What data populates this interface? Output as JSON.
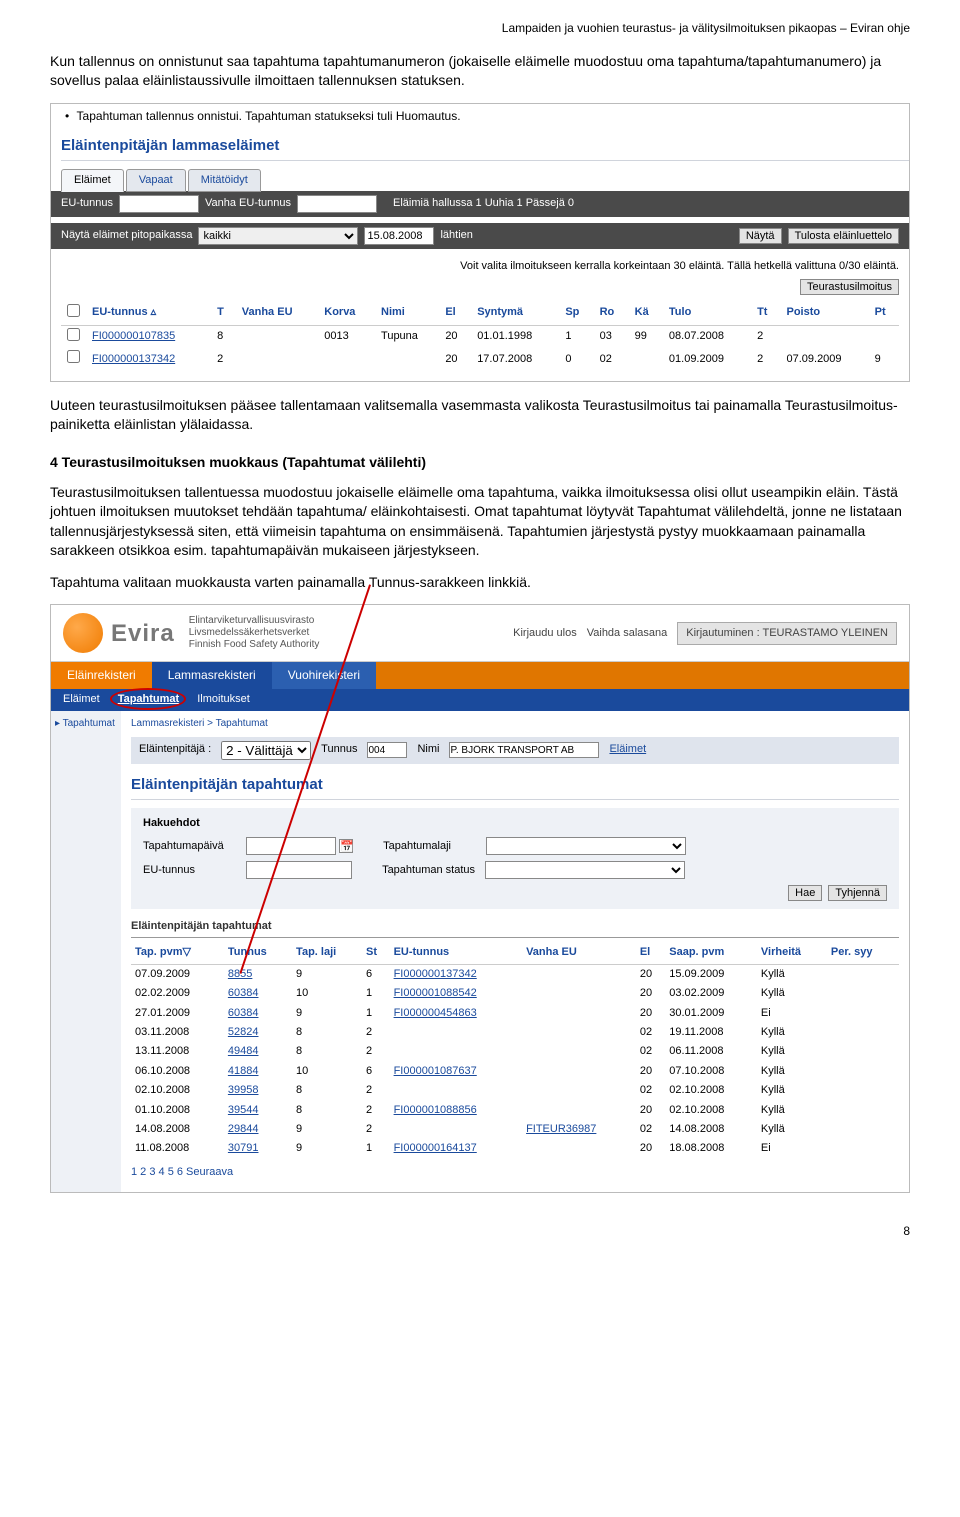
{
  "header_right": "Lampaiden ja vuohien teurastus- ja välitysilmoituksen pikaopas – Eviran ohje",
  "p1": "Kun tallennus on onnistunut saa tapahtuma tapahtumanumeron (jokaiselle eläimelle muodostuu oma tapahtuma/tapahtumanumero) ja sovellus palaa eläinlistaussivulle ilmoittaen tallennuksen statuksen.",
  "bullet1": "Tapahtuman tallennus onnistui. Tapahtuman statukseksi tuli Huomautus.",
  "sc1": {
    "panel_title": "Eläintenpitäjän lammaseläimet",
    "tabs": [
      "Eläimet",
      "Vapaat",
      "Mitätöidyt"
    ],
    "filter": {
      "eu_label": "EU-tunnus",
      "vanha_label": "Vanha EU-tunnus",
      "stats": "Eläimiä hallussa 1 Uuhia 1 Pässejä 0",
      "show_label": "Näytä eläimet pitopaikassa",
      "select_value": "kaikki",
      "date": "15.08.2008",
      "lahtien": "lähtien",
      "btn_nayta": "Näytä",
      "btn_tulosta": "Tulosta eläinluettelo"
    },
    "note": "Voit valita ilmoitukseen kerralla korkeintaan 30 eläintä. Tällä hetkellä valittuna 0/30 eläintä.",
    "btn_teurastus": "Teurastusilmoitus",
    "columns": [
      "",
      "EU-tunnus ▵",
      "T",
      "Vanha EU",
      "Korva",
      "Nimi",
      "El",
      "Syntymä",
      "Sp",
      "Ro",
      "Kä",
      "Tulo",
      "Tt",
      "Poisto",
      "Pt"
    ],
    "rows": [
      [
        "",
        "FI000000107835",
        "8",
        "",
        "0013",
        "Tupuna",
        "20",
        "01.01.1998",
        "1",
        "03",
        "99",
        "08.07.2008",
        "2",
        "",
        ""
      ],
      [
        "",
        "FI000000137342",
        "2",
        "",
        "",
        "",
        "20",
        "17.07.2008",
        "0",
        "02",
        "",
        "01.09.2009",
        "2",
        "07.09.2009",
        "9"
      ]
    ]
  },
  "p2": "Uuteen teurastusilmoituksen pääsee tallentamaan valitsemalla vasemmasta valikosta Teurastusilmoitus tai painamalla Teurastusilmoitus-painiketta eläinlistan ylälaidassa.",
  "h1": "4 Teurastusilmoituksen muokkaus (Tapahtumat välilehti)",
  "p3": "Teurastusilmoituksen tallentuessa muodostuu jokaiselle eläimelle oma tapahtuma, vaikka ilmoituksessa olisi ollut useampikin eläin. Tästä johtuen ilmoituksen muutokset tehdään tapahtuma/ eläinkohtaisesti. Omat tapahtumat löytyvät Tapahtumat välilehdeltä, jonne ne listataan tallennusjärjestyksessä siten, että viimeisin tapahtuma on ensimmäisenä. Tapahtumien järjestystä pystyy muokkaamaan painamalla sarakkeen otsikkoa esim. tapahtumapäivän mukaiseen järjestykseen.",
  "p4": "Tapahtuma valitaan muokkausta varten painamalla Tunnus-sarakkeen linkkiä.",
  "sc2": {
    "logo_name": "Evira",
    "logo_lines": [
      "Elintarviketurvallisuusvirasto",
      "Livsmedelssäkerhetsverket",
      "Finnish Food Safety Authority"
    ],
    "topright_logout": "Kirjaudu ulos",
    "topright_pw": "Vaihda salasana",
    "topright_login": "Kirjautuminen : TEURASTAMO YLEINEN",
    "main_tabs": [
      "Eläinrekisteri",
      "Lammasrekisteri",
      "Vuohirekisteri"
    ],
    "sub_nav": [
      "Eläimet",
      "Tapahtumat",
      "Ilmoitukset"
    ],
    "side_item": "▸ Tapahtumat",
    "breadcrumb": "Lammasrekisteri > Tapahtumat",
    "owner": {
      "label": "Eläintenpitäjä :",
      "sel": "2 - Välittäjä",
      "t_label": "Tunnus",
      "t_val": "004",
      "n_label": "Nimi",
      "n_val": "P. BJÖRK TRANSPORT AB",
      "link": "Eläimet"
    },
    "panel_title": "Eläintenpitäjän tapahtumat",
    "search": {
      "hakuehdot": "Hakuehdot",
      "tapahtumapaiva": "Tapahtumapäivä",
      "eu_tunnus": "EU-tunnus",
      "tapahtumalaji": "Tapahtumalaji",
      "tap_status": "Tapahtuman status",
      "btn_hae": "Hae",
      "btn_tyhjenna": "Tyhjennä"
    },
    "results_title": "Eläintenpitäjän tapahtumat",
    "columns": [
      "Tap. pvm▽",
      "Tunnus",
      "Tap. laji",
      "St",
      "EU-tunnus",
      "Vanha EU",
      "El",
      "Saap. pvm",
      "Virheitä",
      "Per. syy"
    ],
    "rows": [
      [
        "07.09.2009",
        "8855",
        "9",
        "6",
        "FI000000137342",
        "",
        "20",
        "15.09.2009",
        "Kyllä",
        ""
      ],
      [
        "02.02.2009",
        "60384",
        "10",
        "1",
        "FI000001088542",
        "",
        "20",
        "03.02.2009",
        "Kyllä",
        ""
      ],
      [
        "27.01.2009",
        "60384",
        "9",
        "1",
        "FI000000454863",
        "",
        "20",
        "30.01.2009",
        "Ei",
        ""
      ],
      [
        "03.11.2008",
        "52824",
        "8",
        "2",
        "",
        "",
        "02",
        "19.11.2008",
        "Kyllä",
        ""
      ],
      [
        "13.11.2008",
        "49484",
        "8",
        "2",
        "",
        "",
        "02",
        "06.11.2008",
        "Kyllä",
        ""
      ],
      [
        "06.10.2008",
        "41884",
        "10",
        "6",
        "FI000001087637",
        "",
        "20",
        "07.10.2008",
        "Kyllä",
        ""
      ],
      [
        "02.10.2008",
        "39958",
        "8",
        "2",
        "",
        "",
        "02",
        "02.10.2008",
        "Kyllä",
        ""
      ],
      [
        "01.10.2008",
        "39544",
        "8",
        "2",
        "FI000001088856",
        "",
        "20",
        "02.10.2008",
        "Kyllä",
        ""
      ],
      [
        "14.08.2008",
        "29844",
        "9",
        "2",
        "",
        "FITEUR36987",
        "02",
        "14.08.2008",
        "Kyllä",
        ""
      ],
      [
        "11.08.2008",
        "30791",
        "9",
        "1",
        "FI000000164137",
        "",
        "20",
        "18.08.2008",
        "Ei",
        ""
      ]
    ],
    "paging": "1 2 3 4 5 6 Seuraava"
  },
  "page_number": "8"
}
